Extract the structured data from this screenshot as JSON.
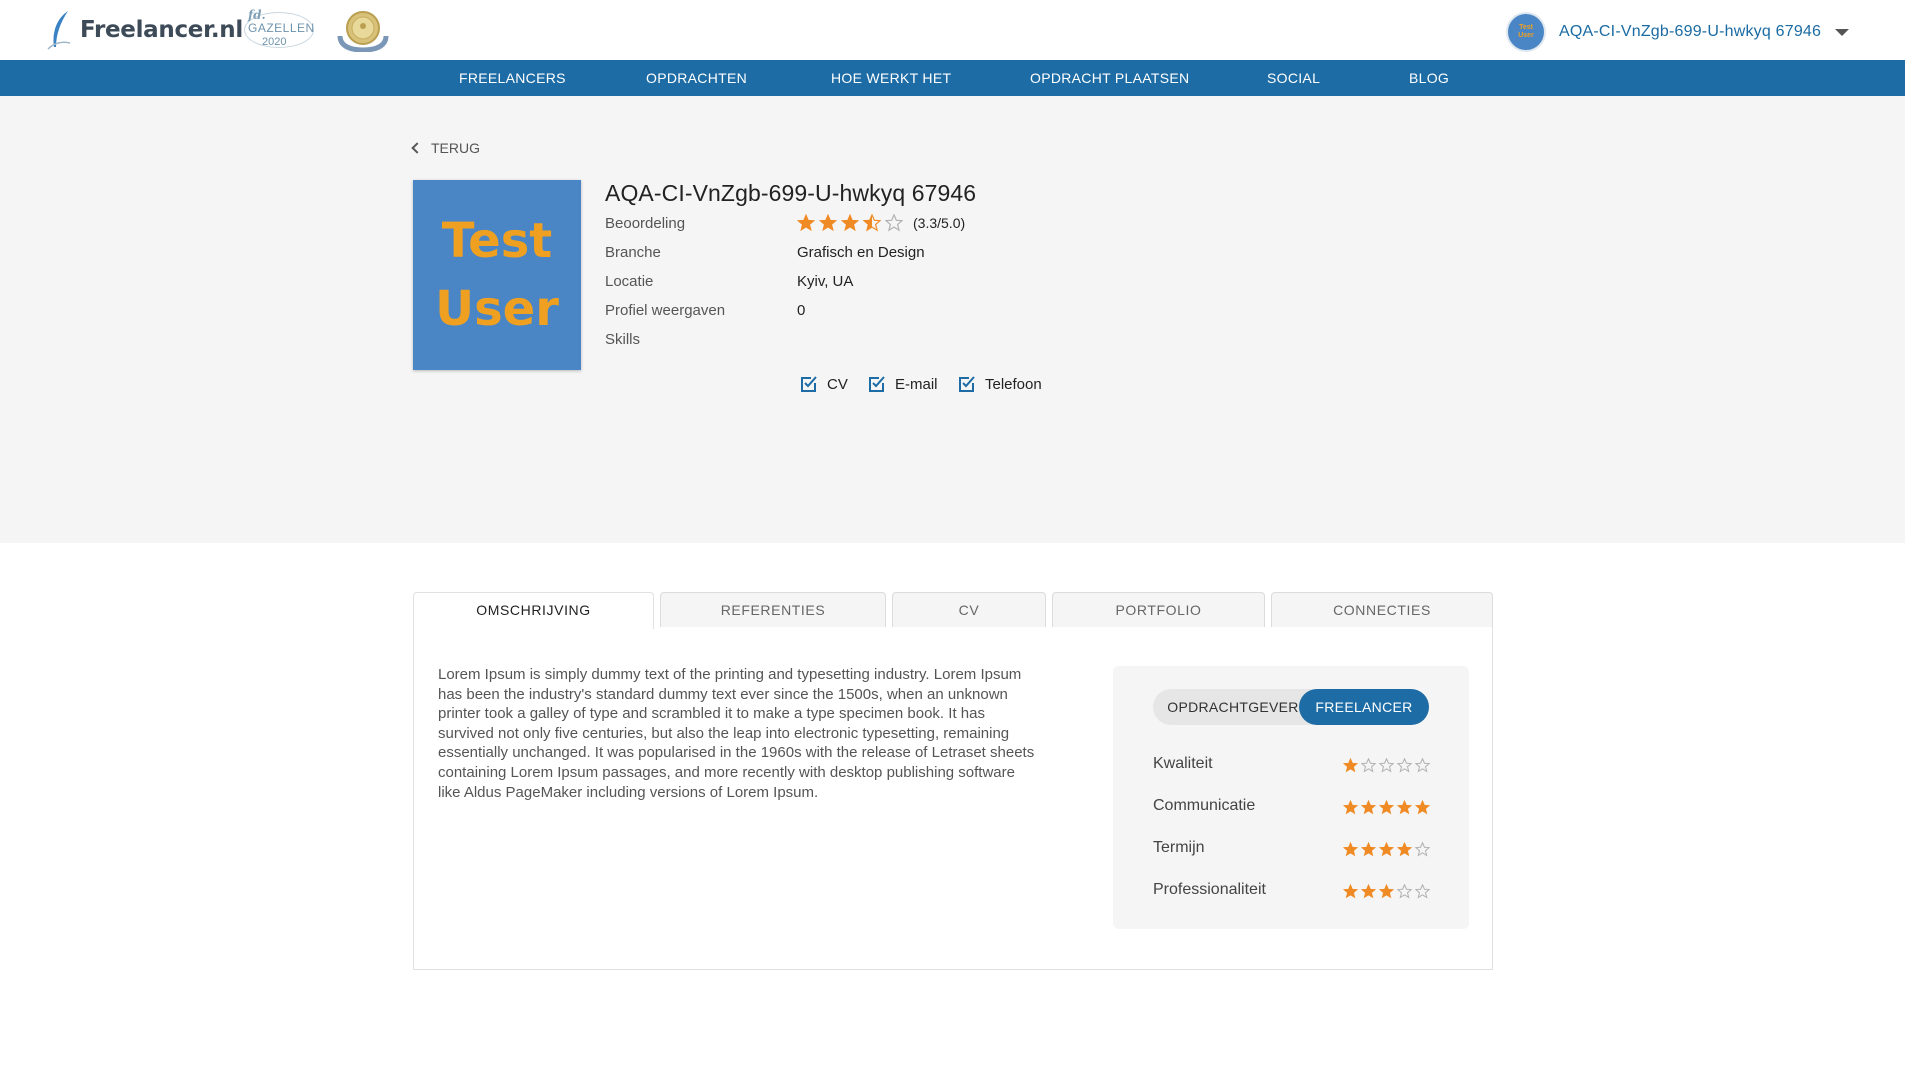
{
  "header": {
    "logo_text": "Freelancer.nl",
    "badge_gazellen_brand": "fd.",
    "badge_gazellen_name": "GAZELLEN",
    "badge_gazellen_year": "2020",
    "user_name": "AQA-CI-VnZgb-699-U-hwkyq 67946",
    "avatar_text_1": "Test",
    "avatar_text_2": "User"
  },
  "nav": {
    "items": [
      {
        "label": "FREELANCERS"
      },
      {
        "label": "OPDRACHTEN"
      },
      {
        "label": "HOE WERKT HET"
      },
      {
        "label": "OPDRACHT PLAATSEN"
      },
      {
        "label": "SOCIAL"
      },
      {
        "label": "BLOG"
      }
    ]
  },
  "profile": {
    "back_label": "TERUG",
    "picture_text_1": "Test",
    "picture_text_2": "User",
    "name": "AQA-CI-VnZgb-699-U-hwkyq 67946",
    "rating_label": "Beoordeling",
    "rating_value": 3.3,
    "rating_text": "(3.3/5.0)",
    "branche_label": "Branche",
    "branche_value": "Grafisch en Design",
    "locatie_label": "Locatie",
    "locatie_value": "Kyiv, UA",
    "views_label": "Profiel weergaven",
    "views_value": "0",
    "skills_label": "Skills",
    "contacts": [
      {
        "label": "CV"
      },
      {
        "label": "E-mail"
      },
      {
        "label": "Telefoon"
      }
    ]
  },
  "tabs": {
    "items": [
      {
        "label": "OMSCHRIJVING"
      },
      {
        "label": "REFERENTIES"
      },
      {
        "label": "CV"
      },
      {
        "label": "PORTFOLIO"
      },
      {
        "label": "CONNECTIES"
      }
    ],
    "active": "OMSCHRIJVING"
  },
  "omschrijving": {
    "text": "Lorem Ipsum is simply dummy text of the printing and typesetting industry. Lorem Ipsum has been the industry's standard dummy text ever since the 1500s, when an unknown printer took a galley of type and scrambled it to make a type specimen book. It has survived not only five centuries, but also the leap into electronic typesetting, remaining essentially unchanged. It was popularised in the 1960s with the release of Letraset sheets containing Lorem Ipsum passages, and more recently with desktop publishing software like Aldus PageMaker including versions of Lorem Ipsum."
  },
  "scores": {
    "toggle_left": "OPDRACHTGEVER",
    "toggle_right": "FREELANCER",
    "toggle_active": "FREELANCER",
    "items": [
      {
        "label": "Kwaliteit",
        "stars": 1
      },
      {
        "label": "Communicatie",
        "stars": 5
      },
      {
        "label": "Termijn",
        "stars": 4
      },
      {
        "label": "Professionaliteit",
        "stars": 3
      }
    ]
  },
  "colors": {
    "brand_blue": "#1d6ca5",
    "star_orange": "#f08a24",
    "star_empty": "#b0b0b0",
    "profile_bg": "#4a86c5",
    "profile_text": "#f0a020"
  }
}
